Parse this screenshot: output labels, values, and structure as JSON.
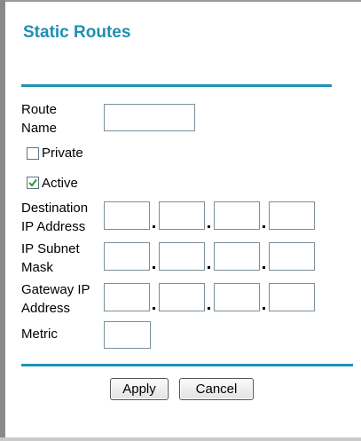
{
  "page": {
    "title": "Static Routes"
  },
  "form": {
    "route_name": {
      "label": "Route\nName",
      "value": ""
    },
    "private": {
      "label": "Private",
      "checked": false
    },
    "active": {
      "label": "Active",
      "checked": true
    },
    "destination_ip": {
      "label": "Destination\nIP Address",
      "octets": [
        "",
        "",
        "",
        ""
      ]
    },
    "subnet_mask": {
      "label": "IP Subnet\nMask",
      "octets": [
        "",
        "",
        "",
        ""
      ]
    },
    "gateway_ip": {
      "label": "Gateway IP\nAddress",
      "octets": [
        "",
        "",
        "",
        ""
      ]
    },
    "metric": {
      "label": "Metric",
      "value": ""
    }
  },
  "buttons": {
    "apply": "Apply",
    "cancel": "Cancel"
  },
  "colors": {
    "accent": "#1d93b6",
    "title": "#1f8fb1"
  },
  "icons": {
    "checkmark": "check-icon"
  }
}
